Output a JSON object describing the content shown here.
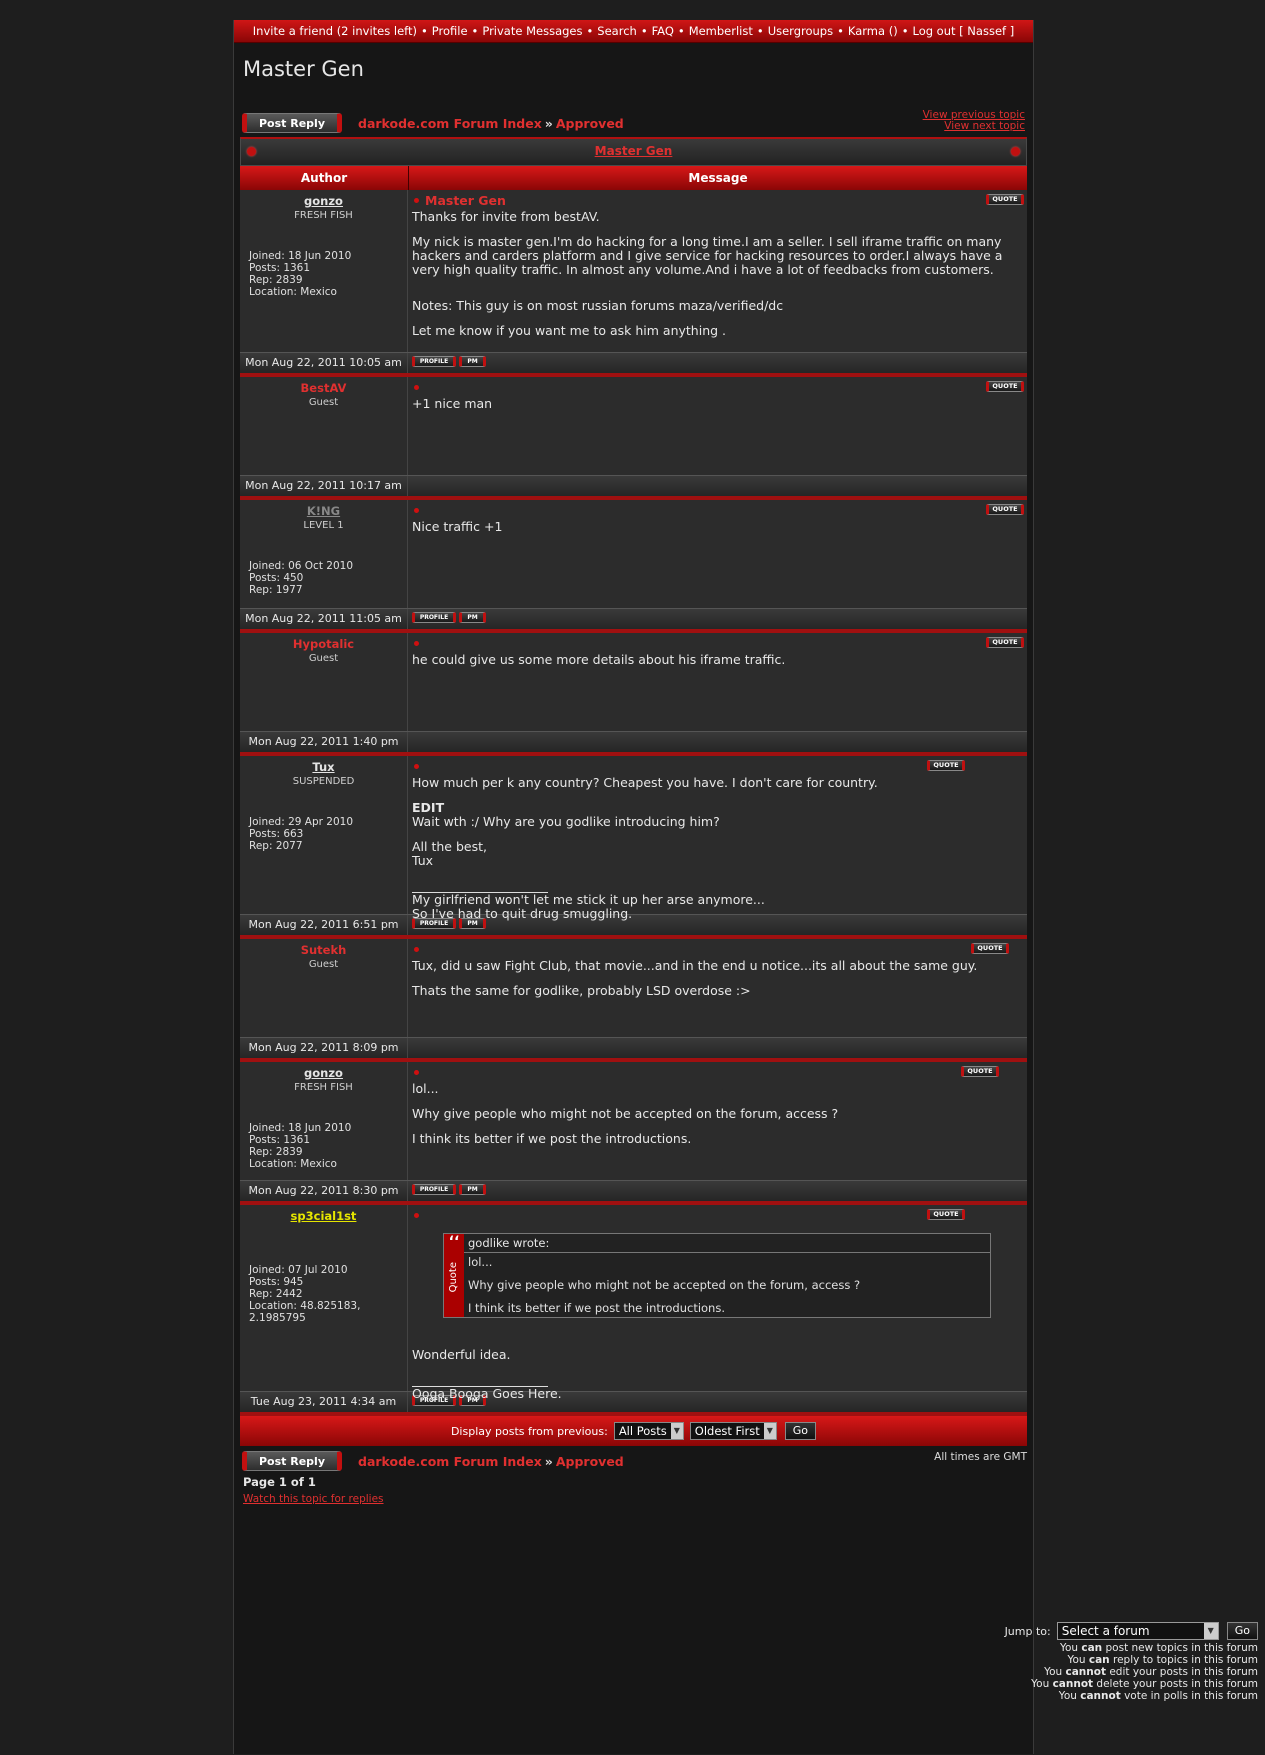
{
  "nav": [
    "Invite a friend (2 invites left)",
    "Profile",
    "Private Messages",
    "Search",
    "FAQ",
    "Memberlist",
    "Usergroups",
    "Karma ()",
    "Log out [ Nassef ]"
  ],
  "nav_sep": "•",
  "page_title": "Master Gen",
  "post_reply": "Post Reply",
  "breadcrumb": {
    "index": "darkode.com Forum Index",
    "arrow": "»",
    "forum": "Approved"
  },
  "topic_links": {
    "prev": "View previous topic",
    "next": "View next topic"
  },
  "thread_title": "Master Gen",
  "columns": {
    "author": "Author",
    "message": "Message"
  },
  "quote_label": "QUOTE",
  "profile_label": "PROFILE",
  "pm_label": "PM",
  "posts": [
    {
      "user": "gonzo",
      "rank": "FRESH FISH",
      "info": [
        "Joined: 18 Jun 2010",
        "Posts: 1361",
        "Rep: 2839",
        "Location: Mexico"
      ],
      "title": "Master Gen",
      "body": [
        "Thanks for invite from bestAV.",
        "",
        "My nick is master gen.I'm do hacking for a long time.I am a seller. I sell iframe traffic on many hackers and carders platform and I give service for hacking resources to order.I always have a very high quality traffic. In almost any volume.And i have a lot of feedbacks from customers.",
        "",
        "",
        "Notes: This guy is on most russian forums maza/verified/dc",
        "",
        "Let me know if you want me to ask him anything ."
      ],
      "date": "Mon Aug 22, 2011 10:05 am"
    },
    {
      "user": "BestAV",
      "rank": "Guest",
      "info": [],
      "title": "",
      "body": [
        "+1 nice man"
      ],
      "date": "Mon Aug 22, 2011 10:17 am"
    },
    {
      "user": "K!NG",
      "rank": "LEVEL 1",
      "info": [
        "Joined: 06 Oct 2010",
        "Posts: 450",
        "Rep: 1977"
      ],
      "title": "",
      "body": [
        "Nice traffic +1"
      ],
      "date": "Mon Aug 22, 2011 11:05 am"
    },
    {
      "user": "Hypotalic",
      "rank": "Guest",
      "info": [],
      "title": "",
      "body": [
        "he could give us some more details about his iframe traffic."
      ],
      "date": "Mon Aug 22, 2011 1:40 pm"
    },
    {
      "user": "Tux",
      "rank": "SUSPENDED",
      "info": [
        "Joined: 29 Apr 2010",
        "Posts: 663",
        "Rep: 2077"
      ],
      "title": "",
      "body": [
        "How much per k any country? Cheapest you have. I don't care for country.",
        "",
        "EDIT",
        "Wait wth :/ Why are you godlike introducing him?",
        "",
        "All the best,",
        "Tux"
      ],
      "sig": [
        "My girlfriend won't let me stick it up her arse anymore...",
        "So I've had to quit drug smuggling."
      ],
      "date": "Mon Aug 22, 2011 6:51 pm"
    },
    {
      "user": "Sutekh",
      "rank": "Guest",
      "info": [],
      "title": "",
      "body": [
        "Tux, did u saw Fight Club, that movie...and in the end u notice...its all about the same guy.",
        "",
        "Thats the same for godlike, probably LSD overdose :>"
      ],
      "date": "Mon Aug 22, 2011 8:09 pm"
    },
    {
      "user": "gonzo",
      "rank": "FRESH FISH",
      "info": [
        "Joined: 18 Jun 2010",
        "Posts: 1361",
        "Rep: 2839",
        "Location: Mexico"
      ],
      "title": "",
      "body": [
        "lol...",
        "",
        "Why give people who might not be accepted on the forum, access ?",
        "",
        "I think its better if we post the introductions."
      ],
      "date": "Mon Aug 22, 2011 8:30 pm"
    },
    {
      "user": "sp3cial1st",
      "rank": "",
      "info": [
        "Joined: 07 Jul 2010",
        "Posts: 945",
        "Rep: 2442",
        "Location: 48.825183,",
        "2.1985795"
      ],
      "title": "",
      "quote": {
        "head": "godlike wrote:",
        "mark": "‘‘",
        "label": "Quote",
        "lines": [
          "lol...",
          "",
          "Why give people who might not be accepted on the forum, access ?",
          "",
          "I think its better if we post the introductions."
        ]
      },
      "body": [
        "Wonderful idea."
      ],
      "sig": [
        "Ooga Booga Goes Here."
      ],
      "date": "Tue Aug 23, 2011 4:34 am"
    }
  ],
  "display": {
    "label": "Display posts from previous:",
    "posts": "All Posts",
    "order": "Oldest First",
    "go": "Go"
  },
  "timezone": "All times are GMT",
  "page_info": "Page 1 of 1",
  "watch": "Watch this topic for replies",
  "jump": {
    "label": "Jump to:",
    "value": "Select a forum",
    "go": "Go"
  },
  "perms": [
    [
      "You ",
      "can",
      " post new topics in this forum"
    ],
    [
      "You ",
      "can",
      " reply to topics in this forum"
    ],
    [
      "You ",
      "cannot",
      " edit your posts in this forum"
    ],
    [
      "You ",
      "cannot",
      " delete your posts in this forum"
    ],
    [
      "You ",
      "cannot",
      " vote in polls in this forum"
    ]
  ]
}
